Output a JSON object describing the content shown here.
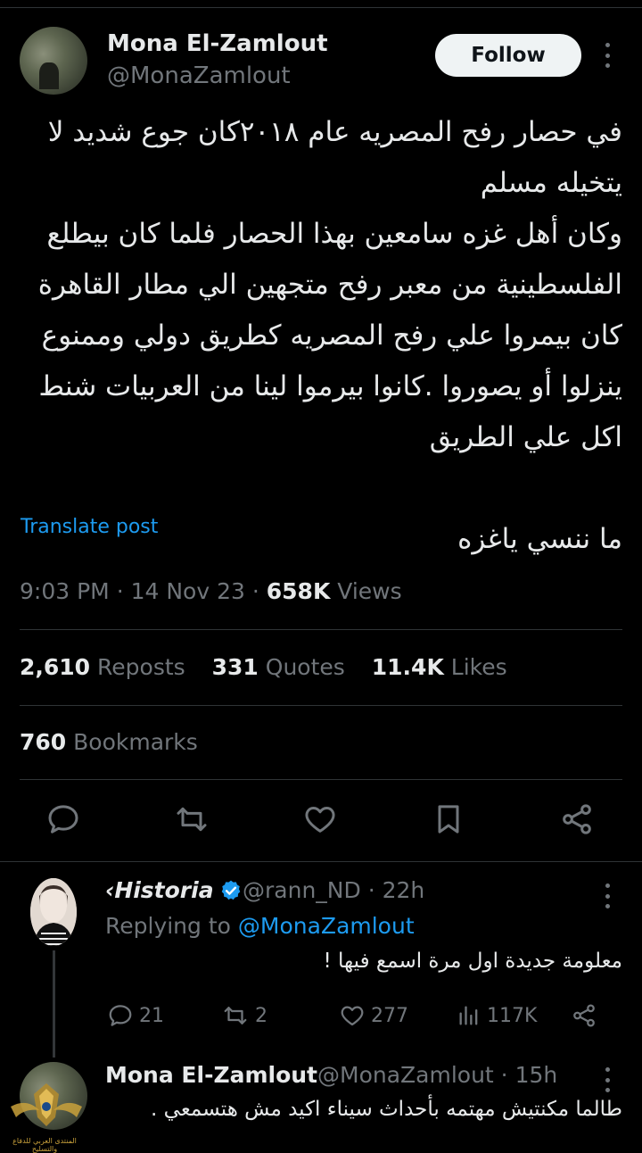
{
  "tweet": {
    "author_name": "Mona El-Zamlout",
    "author_handle": "@MonaZamlout",
    "follow_label": "Follow",
    "text": "في حصار رفح المصريه عام ٢٠١٨كان جوع شديد لا يتخيله مسلم\nوكان أهل غزه سامعين بهذا الحصار فلما كان بيطلع الفلسطينية من معبر رفح متجهين الي مطار القاهرة كان بيمروا علي رفح المصريه كطريق دولي وممنوع ينزلوا أو يصوروا .كانوا بيرموا لينا من العربيات شنط اكل علي الطريق\n\nما ننسي ياغزه",
    "translate_label": "Translate post",
    "time": "9:03 PM",
    "date": "14 Nov 23",
    "views_count": "658K",
    "views_label": "Views",
    "reposts_count": "2,610",
    "reposts_label": "Reposts",
    "quotes_count": "331",
    "quotes_label": "Quotes",
    "likes_count": "11.4K",
    "likes_label": "Likes",
    "bookmarks_count": "760",
    "bookmarks_label": "Bookmarks"
  },
  "actions": [
    "reply-icon",
    "repost-icon",
    "like-icon",
    "bookmark-icon",
    "share-icon"
  ],
  "reply": {
    "author_name": "Historia",
    "author_prefix": "‹",
    "verified": true,
    "author_handle": "@rann_ND",
    "age": "· 22h",
    "replying_prefix": "Replying to",
    "replying_to": "@MonaZamlout",
    "text": "معلومة جديدة اول مرة اسمع فيها !",
    "reply_count": "21",
    "repost_count": "2",
    "like_count": "277",
    "view_count": "117K"
  },
  "bottom_reply": {
    "author_name": "Mona El-Zamlout",
    "author_handle": "@MonaZamlout",
    "age": "· 15h",
    "text": "طالما مكنتيش مهتمه بأحداث سيناء اكيد مش هتسمعي ."
  },
  "watermark_text": "المنتدى العربي للدفاع والتسليح",
  "colors": {
    "accent": "#1d9bf0",
    "muted": "#71767b",
    "text": "#e7e9ea",
    "bg": "#000000",
    "divider": "#2f3336"
  }
}
